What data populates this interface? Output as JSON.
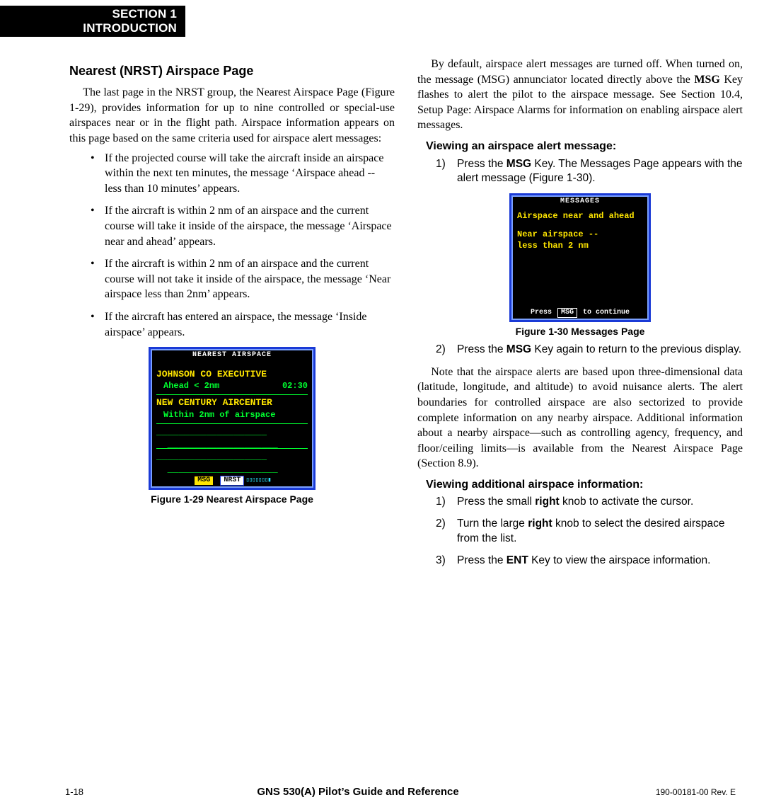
{
  "section_tab": {
    "line1": "SECTION 1",
    "line2": "INTRODUCTION"
  },
  "heading": "Nearest (NRST) Airspace Page",
  "para1": "The last page in the NRST group, the Nearest Airspace Page (Figure 1-29), provides information for up to nine controlled or special-use airspaces near or in the flight path. Airspace information appears on this page based on the same criteria used for airspace alert messages:",
  "bullets": [
    "If the projected course will take the aircraft inside an airspace within the next ten minutes, the message ‘Airspace ahead -- less than 10 minutes’ appears.",
    "If the aircraft is within 2 nm of an airspace and the current course will take it inside of the airspace, the message ‘Airspace near and ahead’ appears.",
    "If the aircraft is within 2 nm of an airspace and the current course will not take it inside of the air­space, the message ‘Near airspace less than 2nm’ appears.",
    "If the aircraft has entered an airspace, the message ‘Inside airspace’ appears."
  ],
  "fig29": {
    "title": "NEAREST AIRSPACE",
    "row1_name": "JOHNSON CO EXECUTIVE",
    "row1_status": "Ahead < 2nm",
    "row1_time": "02:30",
    "row2_name": "NEW CENTURY AIRCENTER",
    "row2_status": "Within 2nm of airspace",
    "tag_msg": "MSG",
    "tag_nrst": "NRST",
    "caption": "Figure 1-29  Nearest Airspace Page"
  },
  "para2_pre": "By default, airspace alert messages are turned off.  When turned on, the message (MSG) annunciator located directly above the ",
  "para2_bold": "MSG",
  "para2_post": " Key flashes to alert the pilot to the airspace message.  See Section 10.4, Setup Page: Airspace Alarms for information on enabling airspace alert messages.",
  "sub1": "Viewing an airspace alert message:",
  "steps1": [
    {
      "n": "1)",
      "pre": "Press the ",
      "b": "MSG",
      "post": " Key.  The Messages Page appears with the alert message (Figure 1-30)."
    },
    {
      "n": "2)",
      "pre": "Press the ",
      "b": "MSG",
      "post": " Key again to return to the previous display."
    }
  ],
  "fig30": {
    "title": "MESSAGES",
    "line1": "Airspace near and ahead",
    "line2": "Near airspace --",
    "line3": " less than 2 nm",
    "foot_pre": "Press",
    "foot_mid": "MSG",
    "foot_post": "to continue",
    "caption": "Figure 1-30  Messages Page"
  },
  "para3": "Note that the airspace alerts are based upon three-dimensional data (latitude, longitude, and altitude) to avoid nuisance alerts.  The alert boundaries for controlled airspace are also sectorized to provide complete information on any nearby airspace.  Additional information about a nearby airspace—such as controlling agency, frequency, and floor/ceiling limits—is available from the Nearest Airspace Page (Section 8.9).",
  "sub2": "Viewing additional airspace information:",
  "steps2": [
    {
      "n": "1)",
      "pre": "Press the small ",
      "b": "right",
      "post": " knob to activate the cursor."
    },
    {
      "n": "2)",
      "pre": "Turn the large ",
      "b": "right",
      "post": " knob to select the desired airspace from the list."
    },
    {
      "n": "3)",
      "pre": "Press the ",
      "b": "ENT",
      "post": " Key to view the airspace information."
    }
  ],
  "footer": {
    "page": "1-18",
    "center": "GNS 530(A) Pilot’s Guide and Reference",
    "right": "190-00181-00  Rev. E"
  }
}
